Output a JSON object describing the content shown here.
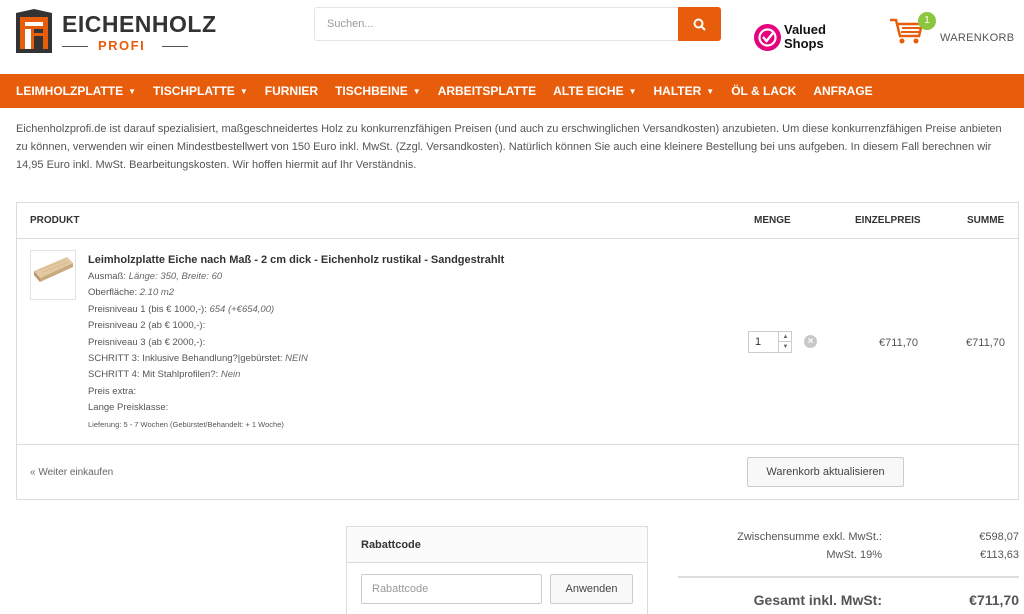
{
  "header": {
    "logo_name": "EICHENHOLZ",
    "logo_sub": "PROFI",
    "search_placeholder": "Suchen...",
    "valued_line1": "Valued",
    "valued_line2": "Shops",
    "cart_count": "1",
    "cart_label": "WARENKORB"
  },
  "nav": {
    "items": [
      {
        "label": "LEIMHOLZPLATTE",
        "dropdown": true
      },
      {
        "label": "TISCHPLATTE",
        "dropdown": true
      },
      {
        "label": "FURNIER",
        "dropdown": false
      },
      {
        "label": "TISCHBEINE",
        "dropdown": true
      },
      {
        "label": "ARBEITSPLATTE",
        "dropdown": false
      },
      {
        "label": "ALTE EICHE",
        "dropdown": true
      },
      {
        "label": "HALTER",
        "dropdown": true
      },
      {
        "label": "ÖL & LACK",
        "dropdown": false
      },
      {
        "label": "ANFRAGE",
        "dropdown": false
      }
    ]
  },
  "intro": "Eichenholzprofi.de ist darauf spezialisiert, maßgeschneidertes Holz zu konkurrenzfähigen Preisen (und auch zu erschwinglichen Versandkosten) anzubieten. Um diese konkurrenzfähigen Preise anbieten zu können, verwenden wir einen Mindestbestellwert von 150 Euro inkl. MwSt. (Zzgl. Versandkosten). Natürlich können Sie auch eine kleinere Bestellung bei uns aufgeben. In diesem Fall berechnen wir 14,95 Euro inkl. MwSt. Bearbeitungskosten. Wir hoffen hiermit auf Ihr Verständnis.",
  "table": {
    "col_product": "PRODUKT",
    "col_qty": "MENGE",
    "col_unit": "EINZELPREIS",
    "col_sum": "SUMME"
  },
  "item": {
    "title": "Leimholzplatte Eiche nach Maß - 2 cm dick - Eichenholz rustikal - Sandgestrahlt",
    "attrs": [
      {
        "label": "Ausmaß: ",
        "value": "Länge: 350, Breite: 60"
      },
      {
        "label": "Oberfläche: ",
        "value": "2.10 m2"
      },
      {
        "label": "Preisniveau 1 (bis € 1000,-): ",
        "value": "654 (+€654,00)"
      },
      {
        "label": "Preisniveau 2 (ab € 1000,-):",
        "value": ""
      },
      {
        "label": "Preisniveau 3 (ab € 2000,-):",
        "value": ""
      },
      {
        "label": "SCHRITT 3: Inklusive Behandlung?|gebürstet: ",
        "value": "NEIN"
      },
      {
        "label": "SCHRITT 4: Mit Stahlprofilen?: ",
        "value": "Nein"
      },
      {
        "label": "Preis extra:",
        "value": ""
      },
      {
        "label": "Lange Preisklasse:",
        "value": ""
      },
      {
        "label": "Lieferung: 5 - 7 Wochen (Gebürstet/Behandelt: + 1 Woche)",
        "value": "",
        "small": true
      }
    ],
    "qty": "1",
    "unit_price": "€711,70",
    "sum": "€711,70"
  },
  "actions": {
    "continue": "« Weiter einkaufen",
    "update": "Warenkorb aktualisieren"
  },
  "coupon": {
    "title": "Rabattcode",
    "placeholder": "Rabattcode",
    "apply": "Anwenden"
  },
  "totals": {
    "subtotal_label": "Zwischensumme exkl. MwSt.:",
    "subtotal": "€598,07",
    "vat_label": "MwSt. 19%",
    "vat": "€113,63",
    "grand_label": "Gesamt inkl. MwSt:",
    "grand": "€711,70"
  },
  "colors": {
    "accent": "#e85d0c",
    "cart_badge": "#8cc63e",
    "valued_brand": "#e6007e"
  }
}
